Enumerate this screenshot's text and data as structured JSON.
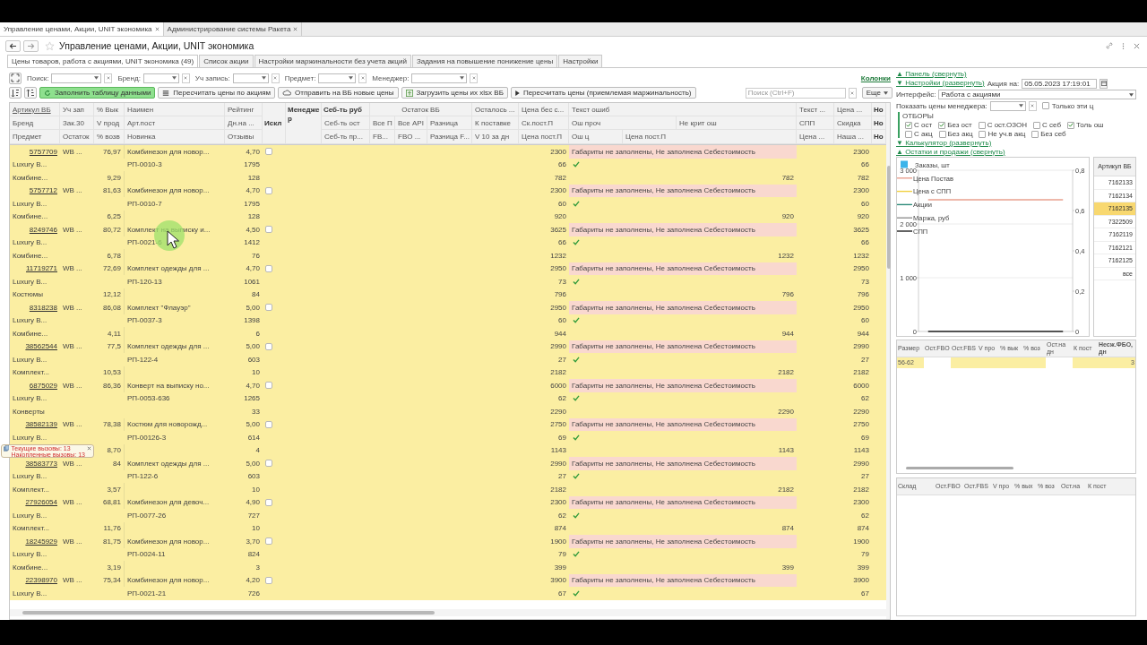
{
  "app_tabs": [
    {
      "label": "Управление ценами, Акции, UNIT экономика",
      "selected": true
    },
    {
      "label": "Администрирование системы Ракета",
      "selected": false
    }
  ],
  "title": "Управление ценами, Акции, UNIT экономика",
  "form_tabs": [
    {
      "label": "Цены товаров, работа с акциями, UNIT экономика (49)",
      "selected": true
    },
    {
      "label": "Список акции",
      "selected": false
    },
    {
      "label": "Настройки маржинальности без учета акций",
      "selected": false
    },
    {
      "label": "Задания на повышение понижение цены",
      "selected": false
    },
    {
      "label": "Настройки",
      "selected": false
    }
  ],
  "filters": [
    "Поиск:",
    "Бренд:",
    "Уч запись:",
    "Предмет:",
    "Менеджер:"
  ],
  "columns_link": "Колонки",
  "toolbar": [
    {
      "label": "Заполнить таблицу данными",
      "kind": "refresh",
      "primary": true
    },
    {
      "label": "Пересчитать цены по акциям",
      "kind": "list",
      "primary": false
    },
    {
      "label": "Отправить на ВБ новые цены",
      "kind": "cloud",
      "primary": false
    },
    {
      "label": "Загрузить цены их xlsx ВБ",
      "kind": "upload",
      "primary": false
    },
    {
      "label": "Пересчитать цены (приемлемая маржинальность)",
      "kind": "play",
      "primary": false
    }
  ],
  "table_search": {
    "placeholder": "Поиск (Ctrl+F)"
  },
  "more_button": "Еще",
  "header": {
    "row_1": [
      "Артикул ВБ",
      "Уч зап",
      "% Вык",
      "Наимен",
      "Рейтинг",
      "Искл",
      "Менедже р",
      "Себ-ть руб",
      "Остаток ВБ",
      "Осталось ...",
      "Цена бес с...",
      "Текст ошиб",
      "Текст ...",
      "Цена ...",
      "Но"
    ],
    "row_2": [
      "Бренд",
      "Зак.30",
      "V прод",
      "Арт.пост",
      "Дн.на ...",
      "Себ-ть ост",
      "Все П",
      "Все API",
      "Разница",
      "К поставке",
      "Ск.пост.П",
      "Ош проч",
      "Не крит ош",
      "СПП",
      "Скидка",
      "Но"
    ],
    "row_3": [
      "Предмет",
      "Остаток",
      "% возв",
      "Новинка",
      "Отзывы",
      "Себ-ть пр...",
      "FB...",
      "FBO ...",
      "Разница F...",
      "V 10 за дн",
      "Цена пост.П",
      "Ош ц",
      "Цена пост.П",
      "Цена ...",
      "Наша ...",
      "Но"
    ]
  },
  "rows": [
    {
      "article": "5757709",
      "account": "WB ...",
      "buyout_pct": "76,97",
      "name": "Комбинезон для новор...",
      "rating": "4,70",
      "excluded": false,
      "price_no_spp": "2300",
      "error_text": "Габариты не заполнены, Не заполнена Себестоимость",
      "price": "2300",
      "brand": "Luxury B...",
      "supplier_article": "РП-0010-3",
      "days_stock": "1795",
      "supplier_discount": "66",
      "other_errors_ok": true,
      "discount": "66",
      "subject": "Комбине...",
      "return_pct": "9,29",
      "reviews": "128",
      "supplier_price": "782",
      "supplier_price_2": "782",
      "our_price": "782"
    },
    {
      "article": "5757712",
      "account": "WB ...",
      "buyout_pct": "81,63",
      "name": "Комбинезон для новор...",
      "rating": "4,70",
      "excluded": false,
      "price_no_spp": "2300",
      "error_text": "Габариты не заполнены, Не заполнена Себестоимость",
      "price": "2300",
      "brand": "Luxury B...",
      "supplier_article": "РП-0010-7",
      "days_stock": "1795",
      "supplier_discount": "60",
      "other_errors_ok": true,
      "discount": "60",
      "subject": "Комбине...",
      "return_pct": "6,25",
      "reviews": "128",
      "supplier_price": "920",
      "supplier_price_2": "920",
      "our_price": "920"
    },
    {
      "article": "8249746",
      "account": "WB ...",
      "buyout_pct": "80,72",
      "name": "Комплект на выписку и...",
      "rating": "4,50",
      "excluded": false,
      "price_no_spp": "3625",
      "error_text": "Габариты не заполнены, Не заполнена Себестоимость",
      "price": "3625",
      "brand": "Luxury B...",
      "supplier_article": "РП-0021-6",
      "days_stock": "1412",
      "supplier_discount": "66",
      "other_errors_ok": true,
      "discount": "66",
      "subject": "Комбине...",
      "return_pct": "6,78",
      "reviews": "76",
      "supplier_price": "1232",
      "supplier_price_2": "1232",
      "our_price": "1232"
    },
    {
      "article": "11719271",
      "account": "WB ...",
      "buyout_pct": "72,69",
      "name": "Комплект одежды для ...",
      "rating": "4,70",
      "excluded": false,
      "price_no_spp": "2950",
      "error_text": "Габариты не заполнены, Не заполнена Себестоимость",
      "price": "2950",
      "brand": "Luxury B...",
      "supplier_article": "РП-120-13",
      "days_stock": "1061",
      "supplier_discount": "73",
      "other_errors_ok": true,
      "discount": "73",
      "subject": "Костюмы",
      "return_pct": "12,12",
      "reviews": "84",
      "supplier_price": "796",
      "supplier_price_2": "796",
      "our_price": "796"
    },
    {
      "article": "8318238",
      "account": "WB ...",
      "buyout_pct": "86,08",
      "name": "Комплект \"Флауэр\"",
      "rating": "5,00",
      "excluded": false,
      "price_no_spp": "2950",
      "error_text": "Габариты не заполнены, Не заполнена Себестоимость",
      "price": "2950",
      "brand": "Luxury B...",
      "supplier_article": "РП-0037-3",
      "days_stock": "1398",
      "supplier_discount": "60",
      "other_errors_ok": true,
      "discount": "60",
      "subject": "Комбине...",
      "return_pct": "4,11",
      "reviews": "6",
      "supplier_price": "944",
      "supplier_price_2": "944",
      "our_price": "944"
    },
    {
      "article": "38562544",
      "account": "WB ...",
      "buyout_pct": "77,5",
      "name": "Комплект одежды для ...",
      "rating": "5,00",
      "excluded": false,
      "price_no_spp": "2990",
      "error_text": "Габариты не заполнены, Не заполнена Себестоимость",
      "price": "2990",
      "brand": "Luxury B...",
      "supplier_article": "РП-122-4",
      "days_stock": "603",
      "supplier_discount": "27",
      "other_errors_ok": true,
      "discount": "27",
      "subject": "Комплект...",
      "return_pct": "10,53",
      "reviews": "10",
      "supplier_price": "2182",
      "supplier_price_2": "2182",
      "our_price": "2182"
    },
    {
      "article": "6875029",
      "account": "WB ...",
      "buyout_pct": "86,36",
      "name": "Конверт на выписку но...",
      "rating": "4,70",
      "excluded": false,
      "price_no_spp": "6000",
      "error_text": "Габариты не заполнены, Не заполнена Себестоимость",
      "price": "6000",
      "brand": "Luxury B...",
      "supplier_article": "РП-0053-636",
      "days_stock": "1265",
      "supplier_discount": "62",
      "other_errors_ok": true,
      "discount": "62",
      "subject": "Конверты",
      "reviews": "33",
      "supplier_price": "2290",
      "supplier_price_2": "2290",
      "our_price": "2290"
    },
    {
      "article": "38582139",
      "account": "WB ...",
      "buyout_pct": "78,38",
      "name": "Костюм для новорожд...",
      "rating": "5,00",
      "excluded": false,
      "price_no_spp": "2750",
      "error_text": "Габариты не заполнены, Не заполнена Себестоимость",
      "price": "2750",
      "brand": "Luxury B...",
      "supplier_article": "РП-00126-3",
      "days_stock": "614",
      "supplier_discount": "69",
      "other_errors_ok": true,
      "discount": "69",
      "return_pct": "8,70",
      "reviews": "4",
      "supplier_price": "1143",
      "supplier_price_2": "1143",
      "our_price": "1143"
    },
    {
      "article": "38583773",
      "account": "WB ...",
      "buyout_pct": "84",
      "name": "Комплект одежды для ...",
      "rating": "5,00",
      "excluded": false,
      "price_no_spp": "2990",
      "error_text": "Габариты не заполнены, Не заполнена Себестоимость",
      "price": "2990",
      "brand": "Luxury B...",
      "supplier_article": "РП-122-6",
      "days_stock": "603",
      "supplier_discount": "27",
      "other_errors_ok": true,
      "discount": "27",
      "subject": "Комплект...",
      "return_pct": "3,57",
      "reviews": "10",
      "supplier_price": "2182",
      "supplier_price_2": "2182",
      "our_price": "2182"
    },
    {
      "article": "27926054",
      "account": "WB ...",
      "buyout_pct": "68,81",
      "name": "Комбинезон для девоч...",
      "rating": "4,90",
      "excluded": false,
      "price_no_spp": "2300",
      "error_text": "Габариты не заполнены, Не заполнена Себестоимость",
      "price": "2300",
      "brand": "Luxury B...",
      "supplier_article": "РП-0077-26",
      "days_stock": "727",
      "supplier_discount": "62",
      "other_errors_ok": true,
      "discount": "62",
      "subject": "Комплект...",
      "return_pct": "11,76",
      "reviews": "10",
      "supplier_price": "874",
      "supplier_price_2": "874",
      "our_price": "874"
    },
    {
      "article": "18245929",
      "account": "WB ...",
      "buyout_pct": "81,75",
      "name": "Комбинезон для новор...",
      "rating": "3,70",
      "excluded": false,
      "price_no_spp": "1900",
      "error_text": "Габариты не заполнены, Не заполнена Себестоимость",
      "price": "1900",
      "brand": "Luxury B...",
      "supplier_article": "РП-0024-11",
      "days_stock": "824",
      "supplier_discount": "79",
      "other_errors_ok": true,
      "discount": "79",
      "subject": "Комбине...",
      "return_pct": "3,19",
      "reviews": "3",
      "supplier_price": "399",
      "supplier_price_2": "399",
      "our_price": "399"
    },
    {
      "article": "22398970",
      "account": "WB ...",
      "buyout_pct": "75,34",
      "name": "Комбинезон для новор...",
      "rating": "4,20",
      "excluded": false,
      "price_no_spp": "3900",
      "error_text": "Габариты не заполнены, Не заполнена Себестоимость",
      "price": "3900",
      "brand": "Luxury B...",
      "supplier_article": "РП-0021-21",
      "days_stock": "726",
      "supplier_discount": "67",
      "other_errors_ok": true,
      "discount": "67"
    }
  ],
  "popup": {
    "lines": [
      "Текущие вызовы: 13",
      "Накопленные вызовы: 13"
    ]
  },
  "panel": {
    "collapse_link": "▲ Панель (свернуть)",
    "settings_link": "▼ Настройки (развернуть)",
    "promo_date_label": "Акция на:",
    "promo_date": "05.05.2023 17:19:01",
    "interface_label": "Интерфейс:",
    "interface_value": "Работа с акциями",
    "manager_prices_label": "Показать цены менеджера:",
    "only_these": {
      "label": "Только эти ц",
      "checked": false
    },
    "filters_title": "ОТБОРЫ",
    "filter_rows": [
      [
        {
          "label": "С ост",
          "checked": true
        },
        {
          "label": "Без ост",
          "checked": true
        },
        {
          "label": "С ост.ОЗОН",
          "checked": false
        },
        {
          "label": "С себ",
          "checked": false
        },
        {
          "label": "Толь ош",
          "checked": true
        }
      ],
      [
        {
          "label": "С акц",
          "checked": false
        },
        {
          "label": "Без акц",
          "checked": false
        },
        {
          "label": "Не уч.в акц",
          "checked": false
        },
        {
          "label": "Без себ",
          "checked": false
        }
      ]
    ],
    "calculator_link": "▼ Калькулятор (развернуть)",
    "stock_link": "▲ Остатки и продажи (свернуть)"
  },
  "chart_data": {
    "type": "line",
    "legend": "upper left",
    "ylim": [
      0,
      3000
    ],
    "y2lim": [
      0,
      0.8
    ],
    "yticks": [
      {
        "value": 0,
        "label": "0"
      },
      {
        "value": 1000,
        "label": "1 000"
      },
      {
        "value": 2000,
        "label": "2 000"
      },
      {
        "value": 3000,
        "label": "3 000"
      }
    ],
    "y2ticks": [
      {
        "value": 0,
        "label": "0"
      },
      {
        "value": 0.2,
        "label": "0,2"
      },
      {
        "value": 0.4,
        "label": "0,4"
      },
      {
        "value": 0.6,
        "label": "0,6"
      },
      {
        "value": 0.8,
        "label": "0,8"
      }
    ],
    "series": [
      {
        "name": "Заказы, шт",
        "color": "#3cb4ea",
        "values": [
          null,
          null
        ]
      },
      {
        "name": "Цена Постав",
        "color": "#e8a08e",
        "values": [
          2450,
          2450,
          2450,
          2450,
          2450,
          2450,
          2450,
          2450
        ]
      },
      {
        "name": "Цена с СПП",
        "color": "#f0d040",
        "values": [
          null,
          null
        ]
      },
      {
        "name": "Акции",
        "color": "#2e8b7a",
        "values": [
          null,
          null
        ]
      },
      {
        "name": "Маржа, руб",
        "color": "#909090",
        "values": [
          null,
          null
        ]
      },
      {
        "name": "СПП",
        "color": "#222222",
        "values": [
          0,
          0,
          0,
          0,
          0,
          0,
          0,
          0
        ]
      }
    ]
  },
  "articles": {
    "header": "Артикул ВБ",
    "items": [
      {
        "label": "7162133",
        "selected": false
      },
      {
        "label": "7162134",
        "selected": false
      },
      {
        "label": "7162135",
        "selected": true
      },
      {
        "label": "7322509",
        "selected": false
      },
      {
        "label": "7162119",
        "selected": false
      },
      {
        "label": "7162121",
        "selected": false
      },
      {
        "label": "7162125",
        "selected": false
      },
      {
        "label": "все",
        "selected": false
      }
    ]
  },
  "sizes": {
    "columns": [
      "Размер",
      "Ост.FBO",
      "Ост.FBS",
      "V про",
      "% вык",
      "% воз",
      "Ост.на дн",
      "К пост",
      "Несж.ФБО, дн"
    ],
    "rows": [
      {
        "size": "56-62",
        "fbo_days": "3"
      }
    ]
  },
  "warehouses": {
    "columns": [
      "Склад",
      "Ост.FBO",
      "Ост.FBS",
      "V про",
      "% вых",
      "% воз",
      "Ост.на",
      "К пост"
    ]
  }
}
